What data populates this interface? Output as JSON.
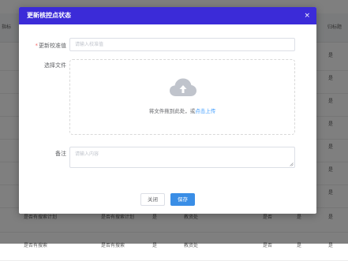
{
  "background_table": {
    "header": [
      "指标",
      "归标题"
    ],
    "rows": [
      [
        "",
        "",
        "",
        "",
        "",
        "",
        "是"
      ],
      [
        "",
        "",
        "",
        "",
        "",
        "",
        "是"
      ],
      [
        "",
        "",
        "",
        "",
        "",
        "",
        "是"
      ],
      [
        "",
        "",
        "",
        "",
        "",
        "",
        "是"
      ],
      [
        "",
        "",
        "",
        "",
        "",
        "",
        "是"
      ],
      [
        "",
        "",
        "",
        "",
        "",
        "",
        "是"
      ],
      [
        "",
        "",
        "",
        "",
        "",
        "",
        "是"
      ],
      [
        "是否有搜索计划",
        "是否有搜索计划",
        "是",
        "教资处",
        "是否",
        "是",
        "是"
      ],
      [
        "是否有搜索",
        "是否有搜索",
        "是",
        "教资处",
        "是否",
        "是",
        "是"
      ]
    ]
  },
  "dialog": {
    "title": "更新核控点状态",
    "close_symbol": "×",
    "fields": {
      "calibration": {
        "required_mark": "*",
        "label": "更新校准值",
        "placeholder": "请输入校准值"
      },
      "file": {
        "label": "选择文件",
        "drop_text": "将文件拖到此处，或",
        "upload_link": "点击上传"
      },
      "remark": {
        "label": "备注",
        "placeholder": "请输入内容"
      }
    },
    "buttons": {
      "close": "关闭",
      "save": "保存"
    }
  },
  "colors": {
    "header": "#3b2bd8",
    "primary": "#3a8ee6",
    "link": "#409eff",
    "required": "#f56c6c"
  }
}
